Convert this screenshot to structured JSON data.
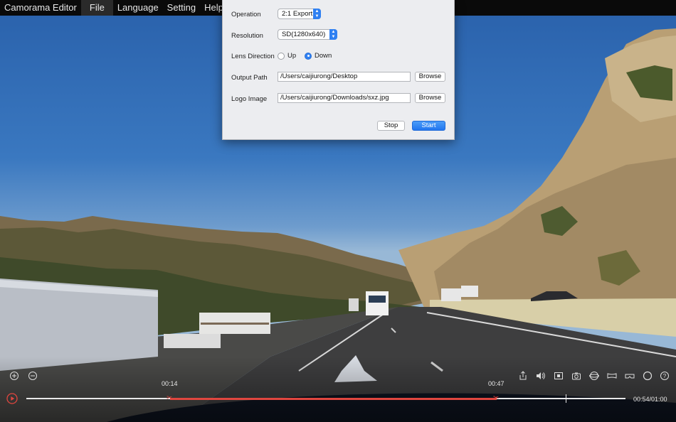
{
  "menubar": {
    "app_name": "Camorama Editor",
    "items": [
      "File",
      "Language",
      "Setting",
      "Help"
    ]
  },
  "dialog": {
    "operation": {
      "label": "Operation",
      "value": "2:1 Export"
    },
    "resolution": {
      "label": "Resolution",
      "value": "SD(1280x640)"
    },
    "lens_direction": {
      "label": "Lens Direction",
      "options": [
        "Up",
        "Down"
      ],
      "selected": "Down"
    },
    "output_path": {
      "label": "Output Path",
      "value": "/Users/caijiurong/Desktop",
      "button": "Browse"
    },
    "logo_image": {
      "label": "Logo Image",
      "value": "/Users/caijiurong/Downloads/sxz.jpg",
      "button": "Browse"
    },
    "stop_label": "Stop",
    "start_label": "Start"
  },
  "player": {
    "in_time": "00:14",
    "out_time": "00:47",
    "time_readout": "00:54/01:00",
    "progress_fraction": 0.9,
    "selection_start_fraction": 0.24,
    "selection_end_fraction": 0.785,
    "accent_color": "#e0463f"
  }
}
